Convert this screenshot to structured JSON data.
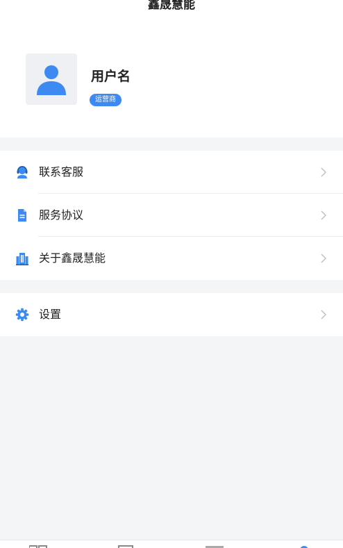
{
  "header": {
    "app_title": "鑫晟慧能",
    "username": "用户名",
    "role_badge": "运营商"
  },
  "menu": {
    "group1": [
      {
        "label": "联系客服",
        "icon": "headset-icon"
      },
      {
        "label": "服务协议",
        "icon": "document-icon"
      },
      {
        "label": "关于鑫晟慧能",
        "icon": "building-icon"
      }
    ],
    "group2": [
      {
        "label": "设置",
        "icon": "gear-icon"
      }
    ]
  },
  "colors": {
    "accent": "#3d8bf2",
    "background": "#f4f5f7",
    "surface": "#ffffff",
    "chevron": "#c2c2c2"
  }
}
